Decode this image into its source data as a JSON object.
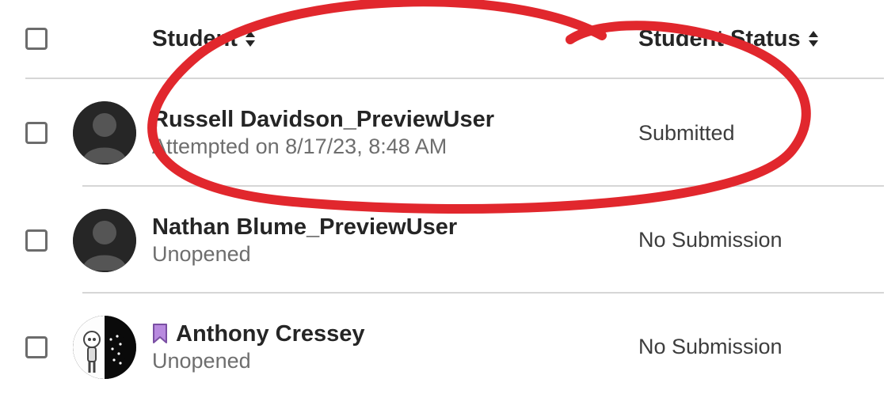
{
  "columns": {
    "student": "Student",
    "status": "Student Status"
  },
  "rows": [
    {
      "name": "Russell Davidson_PreviewUser",
      "sub": "Attempted on 8/17/23, 8:48 AM",
      "status": "Submitted",
      "avatar": "default",
      "bookmarked": false
    },
    {
      "name": "Nathan Blume_PreviewUser",
      "sub": "Unopened",
      "status": "No Submission",
      "avatar": "default",
      "bookmarked": false
    },
    {
      "name": "Anthony Cressey",
      "sub": "Unopened",
      "status": "No Submission",
      "avatar": "cartoon",
      "bookmarked": true
    }
  ]
}
